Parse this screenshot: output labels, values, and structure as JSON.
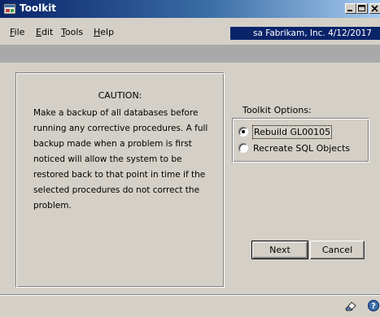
{
  "window": {
    "title": "Toolkit",
    "controls": {
      "minimize": "minimize-icon",
      "maximize": "maximize-icon",
      "close": "close-icon"
    }
  },
  "menu": {
    "items": [
      {
        "label": "File",
        "accel": "F",
        "rest": "ile"
      },
      {
        "label": "Edit",
        "accel": "E",
        "rest": "dit"
      },
      {
        "label": "Tools",
        "accel": "T",
        "rest": "ools"
      },
      {
        "label": "Help",
        "accel": "H",
        "rest": "elp"
      }
    ]
  },
  "company_bar": {
    "text": "sa  Fabrikam, Inc.  4/12/2017"
  },
  "caution": {
    "title": "CAUTION:",
    "body": "Make a backup of all databases before running any corrective procedures.  A full backup made when a problem is first noticed will allow the system to be restored back to that point in time if the selected procedures do not correct the problem."
  },
  "toolkit_options": {
    "label": "Toolkit Options:",
    "options": [
      {
        "label": "Rebuild GL00105",
        "selected": true
      },
      {
        "label": "Recreate SQL Objects",
        "selected": false
      }
    ]
  },
  "buttons": {
    "next": "Next",
    "cancel": "Cancel"
  },
  "status_icons": [
    "eraser-icon",
    "help-icon"
  ],
  "colors": {
    "window_bg": "#d4d0c8",
    "title_bar": "#0a246a",
    "toolbar": "#a9a9a9"
  }
}
